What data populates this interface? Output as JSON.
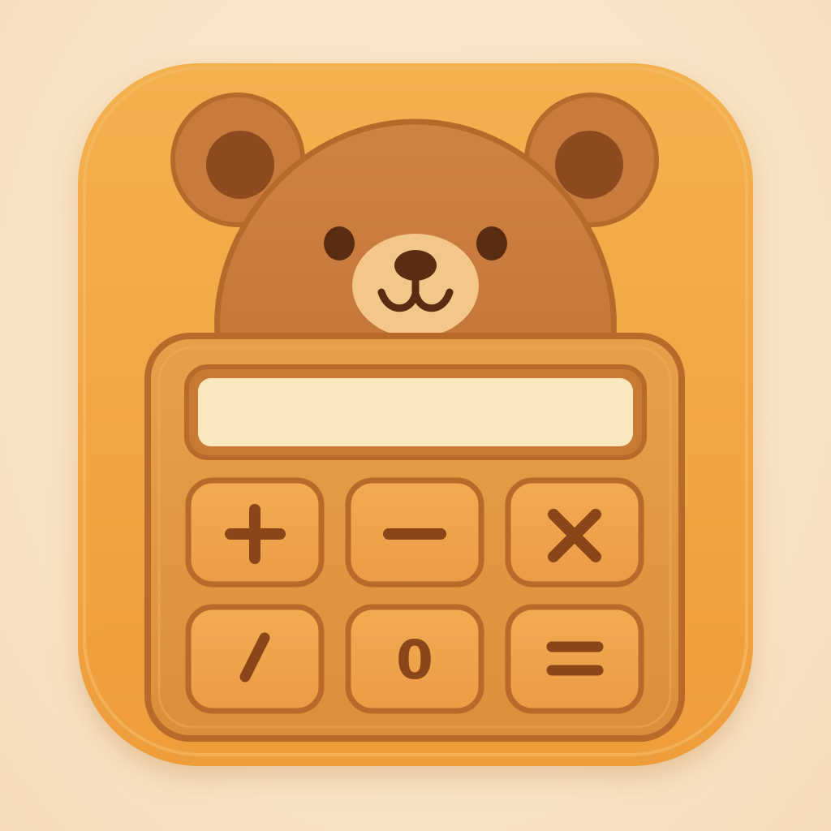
{
  "app_icon": {
    "subject": "bear-calculator",
    "colors": {
      "background": "#f8e2c4",
      "tile": "#f2a845",
      "tile_edge": "#e89636",
      "bear_fur": "#c97b3d",
      "bear_outline": "#b56a2c",
      "inner_ear": "#8e4a1f",
      "muzzle": "#f3c68a",
      "face_features": "#5a2d12",
      "calculator_body": "#e29a44",
      "calculator_outline": "#b86a2a",
      "display": "#fbe7bd",
      "key_face": "#f0a54c",
      "key_outline": "#b86a2a",
      "key_glyph": "#8a4519"
    },
    "display": {
      "value": ""
    },
    "keys": [
      {
        "id": "plus",
        "icon": "plus-icon"
      },
      {
        "id": "minus",
        "icon": "minus-icon"
      },
      {
        "id": "multiply",
        "icon": "multiply-icon"
      },
      {
        "id": "divide",
        "icon": "divide-icon"
      },
      {
        "id": "zero",
        "label": "0"
      },
      {
        "id": "equals",
        "icon": "equals-icon"
      }
    ]
  }
}
